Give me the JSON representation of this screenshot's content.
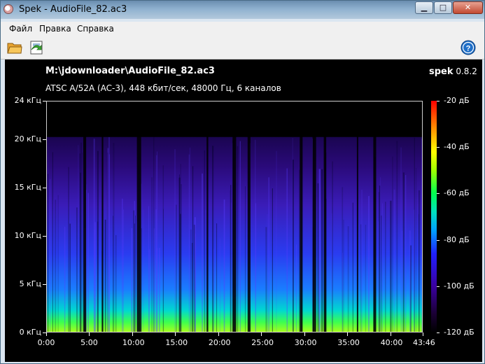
{
  "window": {
    "title": "Spek - AudioFile_82.ac3"
  },
  "menu": {
    "items": [
      "Файл",
      "Правка",
      "Справка"
    ]
  },
  "toolbar": {
    "open_icon": "folder-open-icon",
    "save_icon": "save-export-icon",
    "help_icon": "help-icon"
  },
  "header": {
    "file": "M:\\jdownloader\\AudioFile_82.ac3",
    "brand": "spek",
    "version": "0.8.2",
    "format": "ATSC A/52A (AC-3), 448 кбит/сек, 48000 Гц, 6 каналов"
  },
  "chart_data": {
    "type": "heatmap",
    "title": "",
    "x_ticks": [
      "0:00",
      "5:00",
      "10:00",
      "15:00",
      "20:00",
      "25:00",
      "30:00",
      "35:00",
      "40:00",
      "43:46"
    ],
    "x_tick_seconds": [
      0,
      300,
      600,
      900,
      1200,
      1500,
      1800,
      2100,
      2400,
      2626
    ],
    "y_ticks": [
      "0 кГц",
      "5 кГц",
      "10 кГц",
      "15 кГц",
      "20 кГц",
      "24 кГц"
    ],
    "y_tick_khz": [
      0,
      5,
      10,
      15,
      20,
      24
    ],
    "color_ticks": [
      "-20 дБ",
      "-40 дБ",
      "-60 дБ",
      "-80 дБ",
      "-100 дБ",
      "-120 дБ"
    ],
    "color_tick_db": [
      -20,
      -40,
      -60,
      -80,
      -100,
      -120
    ],
    "xlim_seconds": [
      0,
      2626
    ],
    "ylim_khz": [
      0,
      24
    ],
    "zlim_db": [
      -120,
      -20
    ],
    "cutoff_khz": 20.3,
    "silent_segments_seconds": [
      [
        255,
        275
      ],
      [
        384,
        395
      ],
      [
        630,
        660
      ],
      [
        1118,
        1130
      ],
      [
        1300,
        1325
      ],
      [
        1405,
        1425
      ],
      [
        1770,
        1790
      ],
      [
        1860,
        1885
      ],
      [
        1938,
        1955
      ],
      [
        2170,
        2180
      ],
      [
        2285,
        2305
      ]
    ]
  }
}
